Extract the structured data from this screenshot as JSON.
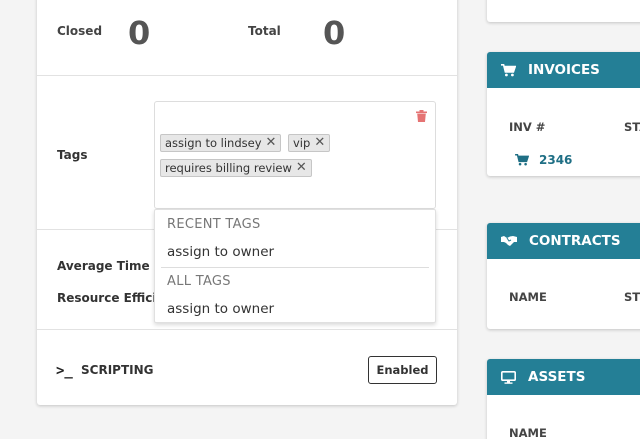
{
  "stats": {
    "closed_label": "Closed",
    "closed_value": "0",
    "total_label": "Total",
    "total_value": "0"
  },
  "tags": {
    "label": "Tags",
    "chips": [
      "assign to lindsey",
      "vip",
      "requires billing review"
    ]
  },
  "dropdown": {
    "recent_header": "RECENT TAGS",
    "recent_items": [
      "assign to owner"
    ],
    "all_header": "ALL TAGS",
    "all_items": [
      "assign to owner"
    ]
  },
  "fields": {
    "avg_time_label": "Average Time Po",
    "resource_eff_label": "Resource Efficie"
  },
  "scripting": {
    "icon": "terminal-icon",
    "label": "SCRIPTING",
    "button_label": "Enabled"
  },
  "invoices": {
    "title": "INVOICES",
    "col_inv": "INV #",
    "col_status": "STA",
    "first_invoice": "2346"
  },
  "contracts": {
    "title": "CONTRACTS",
    "col_name": "NAME",
    "col_status": "ST"
  },
  "assets": {
    "title": "ASSETS",
    "col_name": "NAME"
  },
  "colors": {
    "header_teal": "#247f96",
    "trash_red": "#e57373"
  }
}
